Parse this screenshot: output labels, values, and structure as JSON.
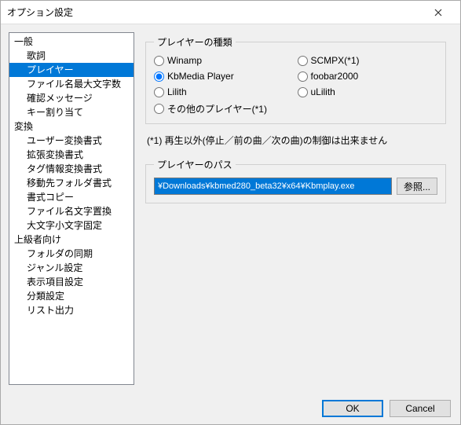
{
  "window": {
    "title": "オプション設定"
  },
  "tree": {
    "groups": [
      {
        "label": "一般",
        "items": [
          "歌詞",
          "プレイヤー",
          "ファイル名最大文字数",
          "確認メッセージ",
          "キー割り当て"
        ]
      },
      {
        "label": "変換",
        "items": [
          "ユーザー変換書式",
          "拡張変換書式",
          "タグ情報変換書式",
          "移動先フォルダ書式",
          "書式コピー",
          "ファイル名文字置換",
          "大文字小文字固定"
        ]
      },
      {
        "label": "上級者向け",
        "items": [
          "フォルダの同期",
          "ジャンル設定",
          "表示項目設定",
          "分類設定",
          "リスト出力"
        ]
      }
    ],
    "selected": "プレイヤー"
  },
  "player_type": {
    "legend": "プレイヤーの種類",
    "options": [
      {
        "label": "Winamp",
        "checked": false
      },
      {
        "label": "SCMPX(*1)",
        "checked": false
      },
      {
        "label": "KbMedia Player",
        "checked": true
      },
      {
        "label": "foobar2000",
        "checked": false
      },
      {
        "label": "Lilith",
        "checked": false
      },
      {
        "label": "uLilith",
        "checked": false
      },
      {
        "label": "その他のプレイヤー(*1)",
        "checked": false
      }
    ],
    "note": "(*1) 再生以外(停止／前の曲／次の曲)の制御は出来ません"
  },
  "player_path": {
    "legend": "プレイヤーのパス",
    "value": "¥Downloads¥kbmed280_beta32¥x64¥Kbmplay.exe",
    "browse": "参照..."
  },
  "footer": {
    "ok": "OK",
    "cancel": "Cancel"
  }
}
